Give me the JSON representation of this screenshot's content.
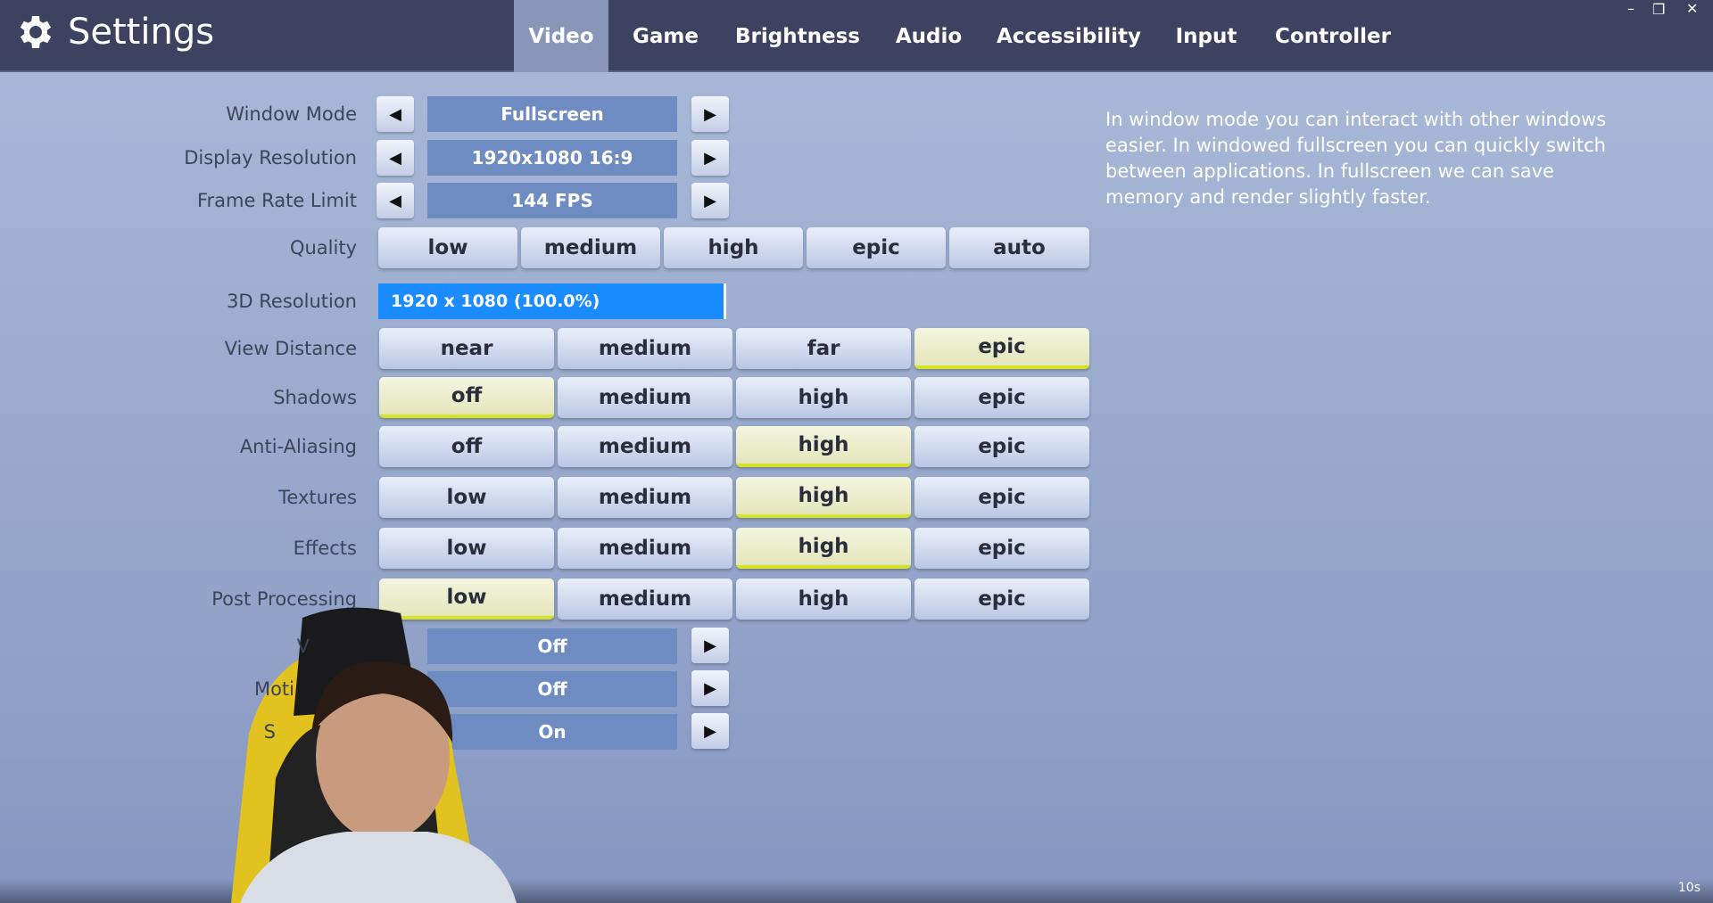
{
  "header": {
    "title": "Settings",
    "tabs": [
      "Video",
      "Game",
      "Brightness",
      "Audio",
      "Accessibility",
      "Input",
      "Controller"
    ],
    "active_tab": "Video"
  },
  "window_controls": {
    "minimize": "–",
    "restore": "❐",
    "close": "✕"
  },
  "settings": {
    "window_mode": {
      "label": "Window Mode",
      "value": "Fullscreen"
    },
    "display_resolution": {
      "label": "Display Resolution",
      "value": "1920x1080 16:9"
    },
    "frame_rate": {
      "label": "Frame Rate Limit",
      "value": "144 FPS"
    },
    "quality": {
      "label": "Quality",
      "options": [
        "low",
        "medium",
        "high",
        "epic",
        "auto"
      ]
    },
    "resolution_3d": {
      "label": "3D Resolution",
      "value": "1920 x 1080 (100.0%)",
      "percent": 100
    },
    "view_distance": {
      "label": "View Distance",
      "options": [
        "near",
        "medium",
        "far",
        "epic"
      ],
      "selected": 3
    },
    "shadows": {
      "label": "Shadows",
      "options": [
        "off",
        "medium",
        "high",
        "epic"
      ],
      "selected": 0
    },
    "anti_aliasing": {
      "label": "Anti-Aliasing",
      "options": [
        "off",
        "medium",
        "high",
        "epic"
      ],
      "selected": 2
    },
    "textures": {
      "label": "Textures",
      "options": [
        "low",
        "medium",
        "high",
        "epic"
      ],
      "selected": 2
    },
    "effects": {
      "label": "Effects",
      "options": [
        "low",
        "medium",
        "high",
        "epic"
      ],
      "selected": 2
    },
    "post_processing": {
      "label": "Post Processing",
      "options": [
        "low",
        "medium",
        "high",
        "epic"
      ],
      "selected": 0
    },
    "toggle1": {
      "label": "V",
      "value": "Off"
    },
    "toggle2": {
      "label": "Moti",
      "value": "Off"
    },
    "toggle3": {
      "label": "S",
      "value": "On"
    }
  },
  "description": "In window mode you can interact with other windows easier. In windowed fullscreen you can quickly switch between applications. In fullscreen we can save memory and render slightly faster.",
  "timer": "10s",
  "colors": {
    "header": "#3d4260",
    "selected_accent": "#d6e22a",
    "resolution_bar": "#1a8cff",
    "value_box": "#6f8cc2"
  }
}
